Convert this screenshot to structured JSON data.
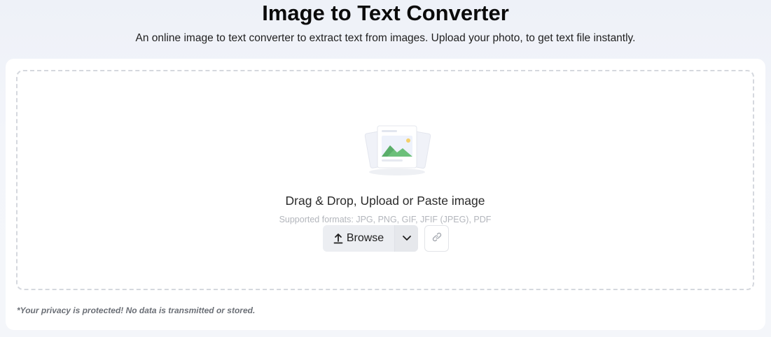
{
  "header": {
    "title": "Image to Text Converter",
    "subtitle": "An online image to text converter to extract text from images. Upload your photo, to get text file instantly."
  },
  "upload": {
    "illustration_icon": "image-stack-icon",
    "drop_title": "Drag & Drop, Upload or Paste image",
    "formats": "Supported formats: JPG, PNG, GIF, JFIF (JPEG), PDF",
    "browse_label": "Browse",
    "browse_icon": "upload-arrow-icon",
    "dropdown_icon": "chevron-down-icon",
    "link_icon": "link-icon"
  },
  "footer": {
    "privacy": "*Your privacy is protected! No data is transmitted or stored."
  },
  "colors": {
    "background": "#f3f5fa",
    "card": "#ffffff",
    "dashed_border": "#d5d8de",
    "button_bg": "#eceef2",
    "muted_text": "#b3b6bc"
  }
}
